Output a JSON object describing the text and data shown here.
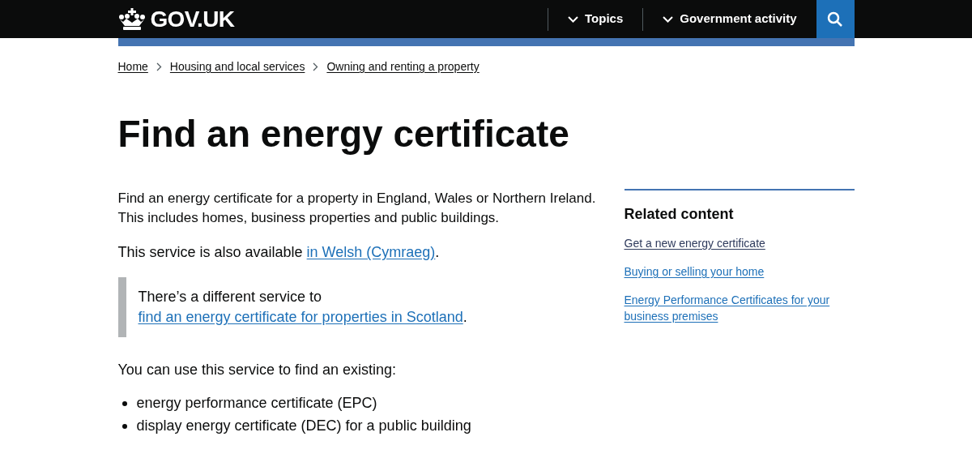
{
  "header": {
    "logo": "GOV.UK",
    "nav": [
      {
        "label": "Topics"
      },
      {
        "label": "Government activity"
      }
    ]
  },
  "breadcrumbs": [
    "Home",
    "Housing and local services",
    "Owning and renting a property"
  ],
  "title": "Find an energy certificate",
  "intro": "Find an energy certificate for a property in England, Wales or Northern Ireland. This includes homes, business properties and public buildings.",
  "welsh": [
    {
      "kind": "text",
      "text": "This service is also available "
    },
    {
      "kind": "link",
      "text": "in Welsh (Cymraeg)"
    },
    {
      "kind": "text",
      "text": "."
    }
  ],
  "inset": [
    {
      "kind": "text",
      "text": "There’s a different service to "
    },
    {
      "kind": "link",
      "text": "find an energy certificate for properties in Scotland"
    },
    {
      "kind": "text",
      "text": "."
    }
  ],
  "list_intro": "You can use this service to find an existing:",
  "bullets": [
    "energy performance certificate (EPC)",
    "display energy certificate (DEC) for a public building"
  ],
  "related": {
    "heading": "Related content",
    "links": [
      "Get a new energy certificate",
      "Buying or selling your home",
      "Energy Performance Certificates for your business premises"
    ]
  }
}
